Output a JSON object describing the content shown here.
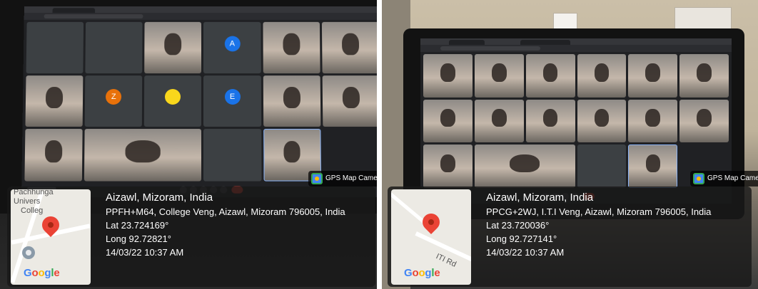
{
  "photos": [
    {
      "badge": "GPS Map Camera",
      "map": {
        "labels": [
          "Pachhunga",
          "Univers",
          "Colleg"
        ],
        "logo": "Google"
      },
      "location": {
        "title": "Aizawl, Mizoram, India",
        "address": "PPFH+M64, College Veng, Aizawl, Mizoram 796005, India",
        "lat": "Lat 23.724169°",
        "long": "Long 92.72821°",
        "datetime": "14/03/22 10:37 AM"
      }
    },
    {
      "badge": "GPS Map Camera",
      "map": {
        "labels": [
          "ITI Rd"
        ],
        "logo": "Google"
      },
      "location": {
        "title": "Aizawl, Mizoram, India",
        "address": "PPCG+2WJ, I.T.I Veng, Aizawl, Mizoram 796005, India",
        "lat": "Lat 23.720036°",
        "long": "Long 92.727141°",
        "datetime": "14/03/22 10:37 AM"
      }
    }
  ],
  "colors": {
    "pin": "#ea4335",
    "google_blue": "#4285f4",
    "google_red": "#ea4335",
    "google_yellow": "#fbbc05",
    "google_green": "#34a853",
    "avatar_blue": "#1a73e8",
    "avatar_orange": "#e8710a",
    "avatar_yellow": "#f9d71c",
    "meet_end_call": "#ea4335"
  },
  "icons": [
    "map-pin-icon",
    "gps-map-camera-logo-icon",
    "end-call-icon"
  ]
}
